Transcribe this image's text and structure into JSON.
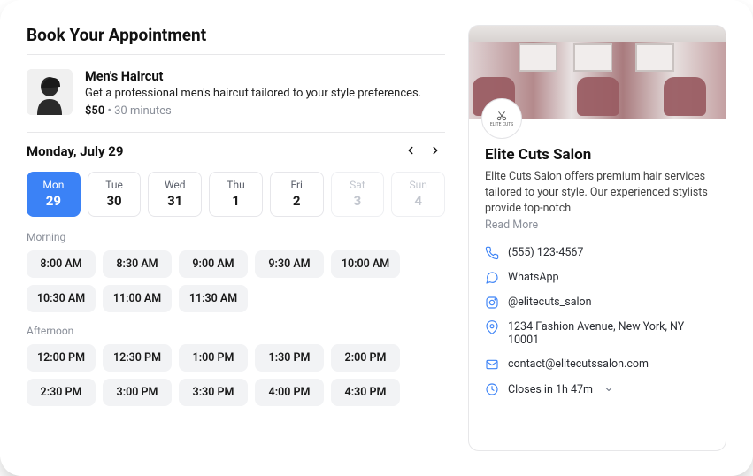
{
  "page_title": "Book Your Appointment",
  "service": {
    "title": "Men's Haircut",
    "desc": "Get a professional men's haircut tailored to your style preferences.",
    "price": "$50",
    "separator": " • ",
    "duration": "30 minutes"
  },
  "calendar": {
    "label": "Monday, July 29",
    "days": [
      {
        "dow": "Mon",
        "num": "29",
        "state": "selected"
      },
      {
        "dow": "Tue",
        "num": "30",
        "state": "enabled"
      },
      {
        "dow": "Wed",
        "num": "31",
        "state": "enabled"
      },
      {
        "dow": "Thu",
        "num": "1",
        "state": "enabled"
      },
      {
        "dow": "Fri",
        "num": "2",
        "state": "enabled"
      },
      {
        "dow": "Sat",
        "num": "3",
        "state": "disabled"
      },
      {
        "dow": "Sun",
        "num": "4",
        "state": "disabled"
      }
    ]
  },
  "sections": [
    {
      "label": "Morning",
      "slots": [
        "8:00 AM",
        "8:30 AM",
        "9:00 AM",
        "9:30 AM",
        "10:00 AM",
        "10:30 AM",
        "11:00 AM",
        "11:30 AM"
      ]
    },
    {
      "label": "Afternoon",
      "slots": [
        "12:00 PM",
        "12:30 PM",
        "1:00 PM",
        "1:30 PM",
        "2:00 PM",
        "2:30 PM",
        "3:00 PM",
        "3:30 PM",
        "4:00 PM",
        "4:30 PM"
      ]
    }
  ],
  "salon": {
    "logo_text": "ELITE CUTS",
    "name": "Elite Cuts Salon",
    "desc": "Elite Cuts Salon offers premium hair services tailored to your style. Our experienced stylists provide top-notch",
    "read_more": "Read More",
    "contacts": {
      "phone": "(555) 123-4567",
      "whatsapp": "WhatsApp",
      "instagram": "@elitecuts_salon",
      "address": "1234 Fashion Avenue, New York, NY 10001",
      "email": "contact@elitecutssalon.com",
      "hours": "Closes in 1h 47m"
    }
  }
}
